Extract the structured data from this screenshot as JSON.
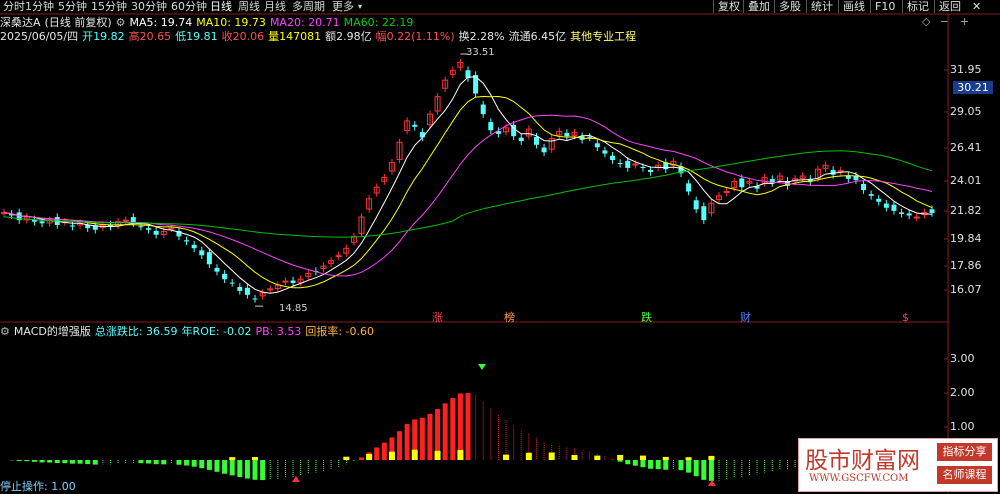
{
  "toolbar": {
    "timeframes": [
      "分时",
      "1分钟",
      "5分钟",
      "15分钟",
      "30分钟",
      "60分钟",
      "日线",
      "周线",
      "月线",
      "多周期",
      "更多"
    ],
    "active_index": 6,
    "right_buttons": [
      "复权",
      "叠加",
      "多股",
      "统计",
      "画线",
      "F10",
      "标记",
      "返回"
    ]
  },
  "header": {
    "name": "深桑达A",
    "mode": "(日线 前复权)",
    "ma5": "MA5: 19.74",
    "ma10": "MA10: 19.73",
    "ma20": "MA20: 20.71",
    "ma60": "MA60: 22.19",
    "date": "2025/06/05/四",
    "open": "开19.82",
    "high": "高20.65",
    "low": "低19.81",
    "close": "收20.06",
    "volume": "量147081",
    "amount": "额2.98亿",
    "change": "幅0.22(1.11%)",
    "turnover": "换2.28%",
    "float": "流通6.45亿",
    "concept": "其他专业工程"
  },
  "colors": {
    "up": "#ff3232",
    "down": "#54ffff",
    "ma5": "#ffffff",
    "ma10": "#ffff00",
    "ma20": "#ff40ff",
    "ma60": "#00c000",
    "macd_up": "#ff2020",
    "macd_down": "#33ff33",
    "macd_yellow": "#ffff00"
  },
  "price_axis": {
    "ticks": [
      "31.95",
      "29.05",
      "26.41",
      "24.01",
      "21.82",
      "19.84",
      "17.86",
      "16.07"
    ],
    "current": "30.21"
  },
  "annotations": {
    "high": "33.51",
    "low": "14.85"
  },
  "events": [
    "涨",
    "榜",
    "跌",
    "财",
    "$"
  ],
  "macd_panel": {
    "title": "MACD的增强版",
    "zdb": "总涨跌比: 36.59",
    "roe": "年ROE: -0.02",
    "pb": "PB: 3.53",
    "ret": "回报率: -0.60",
    "ticks": [
      "3.00",
      "2.00",
      "1.00"
    ],
    "stop_label": "停止操作: 1.00"
  },
  "watermark": {
    "brand": "股市财富网",
    "url": "WWW.GSCFW.COM",
    "btn1": "指标分享",
    "btn2": "名师课程"
  },
  "chart_data": {
    "type": "candlestick",
    "closes": [
      20.1,
      19.9,
      19.6,
      19.8,
      19.5,
      19.4,
      19.6,
      19.3,
      19.5,
      19.2,
      19.4,
      19.1,
      19.0,
      19.3,
      19.2,
      19.5,
      19.6,
      19.4,
      19.2,
      19.0,
      18.7,
      18.9,
      19.1,
      18.6,
      18.3,
      17.9,
      17.5,
      17.0,
      16.6,
      16.2,
      16.0,
      15.6,
      15.4,
      15.2,
      15.5,
      15.7,
      15.9,
      16.1,
      16.0,
      16.2,
      16.5,
      16.6,
      16.9,
      17.2,
      17.5,
      17.9,
      18.6,
      19.8,
      21.0,
      21.8,
      22.5,
      23.6,
      25.2,
      27.0,
      26.5,
      25.6,
      27.6,
      29.2,
      30.8,
      31.8,
      32.6,
      31.0,
      29.5,
      27.6,
      26.2,
      25.9,
      26.4,
      25.7,
      25.3,
      26.3,
      25.0,
      24.4,
      25.5,
      26.1,
      25.7,
      26.0,
      25.4,
      25.6,
      24.8,
      24.3,
      23.8,
      23.5,
      23.2,
      23.5,
      23.2,
      22.9,
      23.4,
      23.1,
      23.7,
      22.8,
      21.5,
      20.3,
      19.6,
      20.7,
      21.2,
      21.5,
      22.2,
      21.8,
      22.2,
      21.7,
      22.5,
      22.1,
      22.6,
      21.9,
      22.4,
      22.6,
      22.2,
      23.1,
      23.4,
      22.7,
      23.0,
      22.4,
      22.3,
      21.6,
      21.2,
      20.8,
      20.4,
      20.2,
      20.0,
      19.9,
      19.8,
      20.1,
      20.06
    ],
    "extremes": {
      "high": 33.51,
      "low": 14.85
    }
  }
}
